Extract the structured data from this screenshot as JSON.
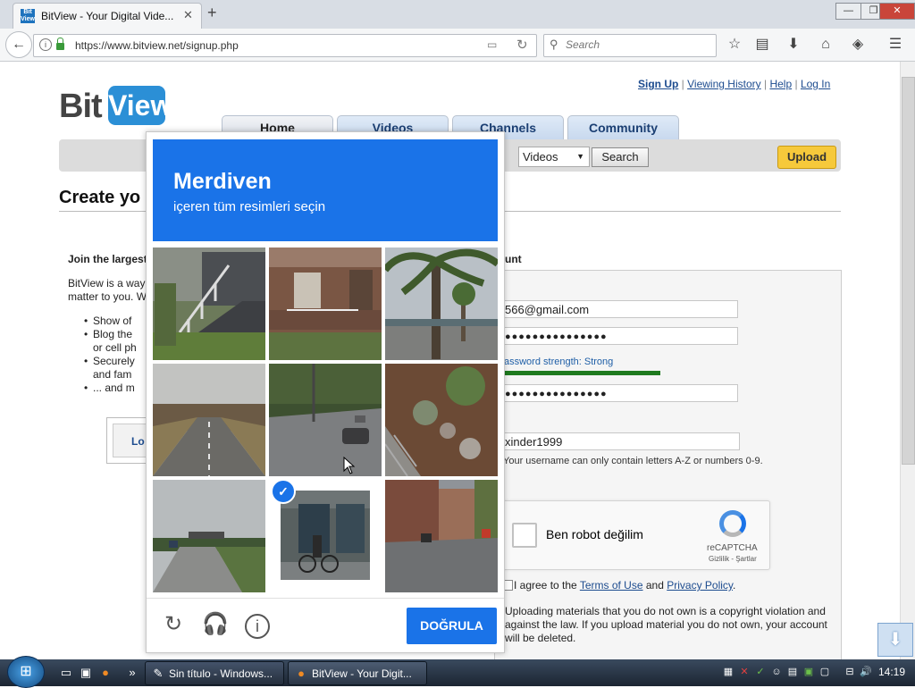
{
  "browser": {
    "tab_title": "BitView - Your Digital Vide...",
    "tab_favicon": "Bit View",
    "url": "https://www.bitview.net/signup.php",
    "search_placeholder": "Search",
    "new_tab": "+",
    "window_controls": {
      "minimize": "—",
      "maximize": "❐",
      "close": "✕"
    }
  },
  "site": {
    "logo_bit": "Bit",
    "logo_view": "View",
    "top_links": {
      "sign_up": "Sign Up",
      "viewing_history": "Viewing History",
      "help": "Help",
      "log_in": "Log In",
      "separator": "|"
    },
    "nav_tabs": [
      "Home",
      "Videos",
      "Channels",
      "Community"
    ],
    "search_scope": "Videos",
    "search_button": "Search",
    "upload_button": "Upload",
    "page_title": "Create yo",
    "join_heading": "Join the largest",
    "intro": "BitView is a way matter to you. W",
    "bullets": [
      "Show of",
      "Blog the",
      "or cell ph",
      "Securely",
      "and fam",
      "... and m"
    ],
    "login_box": "Lo",
    "account_heading": "unt"
  },
  "form": {
    "email_value": "566@gmail.com",
    "password_value": "●●●●●●●●●●●●●●●",
    "password_strength": "assword strength: Strong",
    "password_strength_level": 0.55,
    "confirm_value": "●●●●●●●●●●●●●●●",
    "username_value": "xinder1999",
    "username_hint": "Your username can only contain letters A-Z or numbers 0-9.",
    "recaptcha_label": "Ben robot değilim",
    "recaptcha_brand": "reCAPTCHA",
    "recaptcha_links": "Gizlilik - Şartlar",
    "agree_prefix": "I agree to the ",
    "terms_link": "Terms of Use",
    "agree_and": " and ",
    "privacy_link": "Privacy Policy",
    "agree_suffix": ".",
    "warning": "Uploading materials that you do not own is a copyright violation and against the law. If you upload material you do not own, your account will be deleted."
  },
  "captcha": {
    "keyword": "Merdiven",
    "instruction": "içeren tüm resimleri seçin",
    "verify_button": "DOĞRULA",
    "icons": [
      "reload-icon",
      "headphones-icon",
      "info-icon"
    ],
    "selected_tile": 7,
    "tiles": [
      {
        "scene": "stairs-porch"
      },
      {
        "scene": "house-porch"
      },
      {
        "scene": "palm-street"
      },
      {
        "scene": "rural-road"
      },
      {
        "scene": "intersection"
      },
      {
        "scene": "rocky-steps"
      },
      {
        "scene": "highway"
      },
      {
        "scene": "cyclist-storefront"
      },
      {
        "scene": "city-street"
      }
    ]
  },
  "taskbar": {
    "tasks": [
      "Sin título - Windows...",
      "BitView - Your Digit..."
    ],
    "clock": "14:19"
  },
  "colors": {
    "captcha_blue": "#1a73e8",
    "link_blue": "#1d4c8f",
    "upload_yellow": "#f6c93b",
    "strength_green": "#1f7a1f"
  }
}
